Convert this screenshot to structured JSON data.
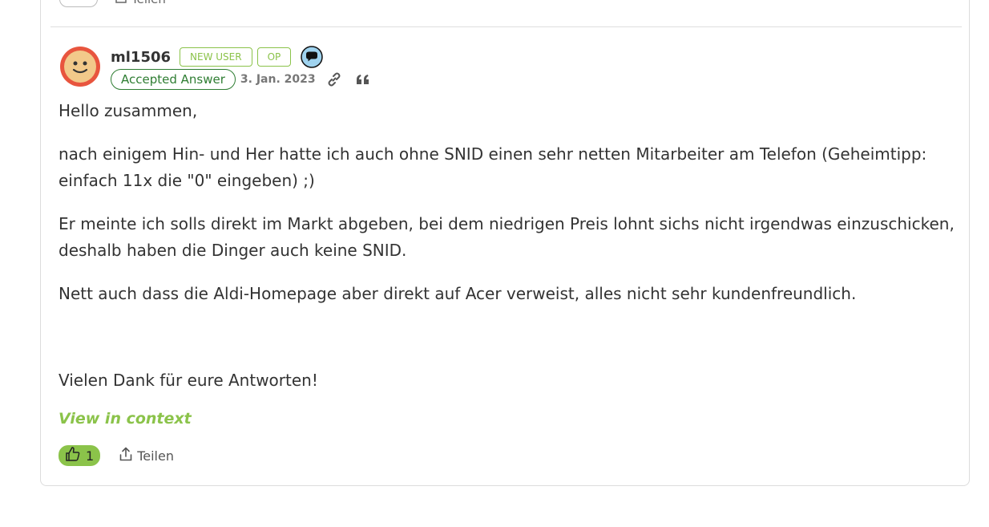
{
  "previous_post": {
    "share_label": "Teilen"
  },
  "post": {
    "author": {
      "username": "ml1506",
      "badges": [
        "NEW USER",
        "OP"
      ]
    },
    "accepted_label": "Accepted Answer",
    "date": "3. Jan. 2023",
    "paragraphs": [
      "Hello zusammen,",
      "nach einigem Hin- und Her hatte ich auch ohne SNID einen sehr netten Mitarbeiter am Telefon (Geheimtipp: einfach 11x die \"0\" eingeben) ;)",
      "Er meinte ich solls direkt im Markt abgeben, bei dem niedrigen Preis lohnt sichs nicht irgendwas einzuschicken, deshalb haben die Dinger auch keine SNID.",
      "Nett auch dass die Aldi-Homepage aber direkt auf Acer verweist, alles nicht sehr kundenfreundlich.",
      "Vielen Dank für eure Antworten!"
    ],
    "view_in_context": "View in context",
    "like_count": "1",
    "share_label": "Teilen"
  },
  "icons": {
    "avatar": "smiley-avatar",
    "chat": "speech-bubble-icon",
    "link": "link-icon",
    "quote": "quote-icon",
    "like": "thumbs-up-icon",
    "share": "share-icon"
  },
  "colors": {
    "accent_green": "#8bc34a",
    "accepted_green": "#2e7d32",
    "avatar_ring": "#e8553e",
    "avatar_face": "#f2c98a"
  }
}
